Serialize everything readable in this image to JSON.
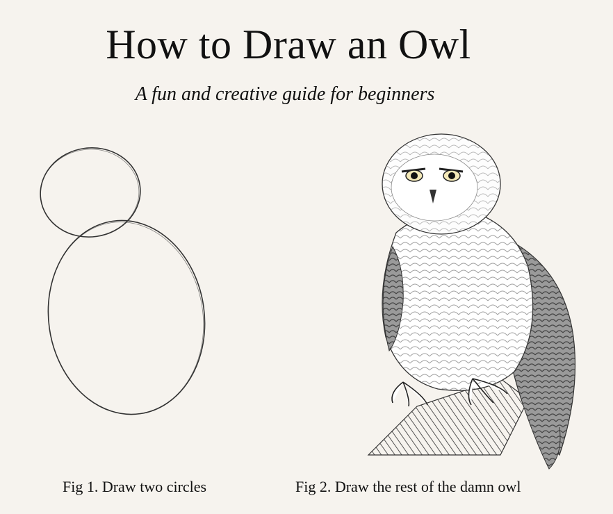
{
  "header": {
    "title": "How to Draw an Owl",
    "subtitle": "A fun and creative guide for beginners"
  },
  "figures": [
    {
      "caption": "Fig 1. Draw two circles",
      "icon": "two-circles-sketch"
    },
    {
      "caption": "Fig 2. Draw the rest of the damn owl",
      "icon": "owl-engraving"
    }
  ],
  "colors": {
    "background": "#f6f3ee",
    "ink": "#111111"
  }
}
